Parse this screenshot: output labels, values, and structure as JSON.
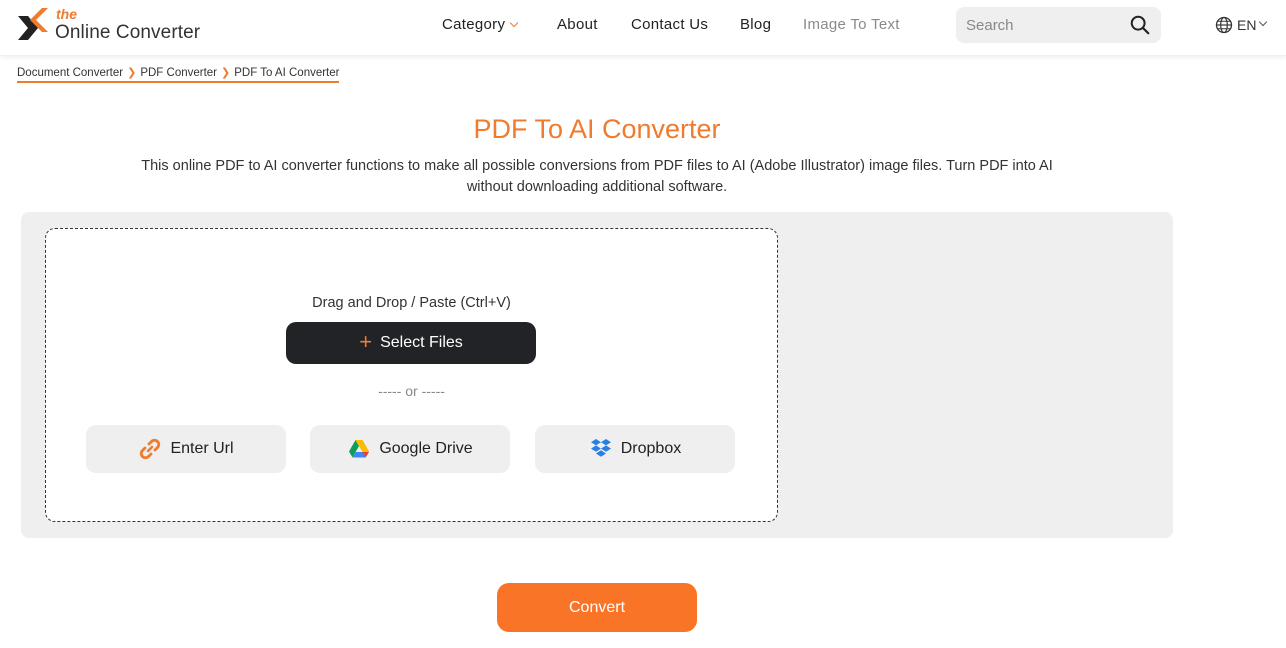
{
  "brand": {
    "logo_small": "the",
    "logo_name": "Online Converter",
    "accent_color": "#f07a2e"
  },
  "nav": {
    "items": [
      {
        "label": "Category",
        "has_dropdown": true
      },
      {
        "label": "About"
      },
      {
        "label": "Contact Us"
      },
      {
        "label": "Blog"
      },
      {
        "label": "Image To Text"
      }
    ]
  },
  "search": {
    "placeholder": "Search",
    "value": "",
    "icon": "search-icon"
  },
  "language": {
    "icon": "globe-icon",
    "label": "EN"
  },
  "breadcrumb": [
    {
      "label": "Document Converter"
    },
    {
      "label": "PDF Converter"
    },
    {
      "label": "PDF To AI Converter"
    }
  ],
  "main": {
    "title": "PDF To AI Converter",
    "description": "This online PDF to AI converter functions to make all possible conversions from PDF files to AI (Adobe Illustrator) image files. Turn PDF into AI without downloading additional software."
  },
  "upload": {
    "drop_label": "Drag and Drop / Paste (Ctrl+V)",
    "select_files_label": "Select Files",
    "select_files_icon": "+",
    "or_separator": "----- or -----",
    "sources": [
      {
        "label": "Enter Url",
        "icon": "link-icon"
      },
      {
        "label": "Google Drive",
        "icon": "google-drive-icon"
      },
      {
        "label": "Dropbox",
        "icon": "dropbox-icon"
      }
    ]
  },
  "actions": {
    "convert_label": "Convert",
    "convert_color": "#f97427"
  }
}
